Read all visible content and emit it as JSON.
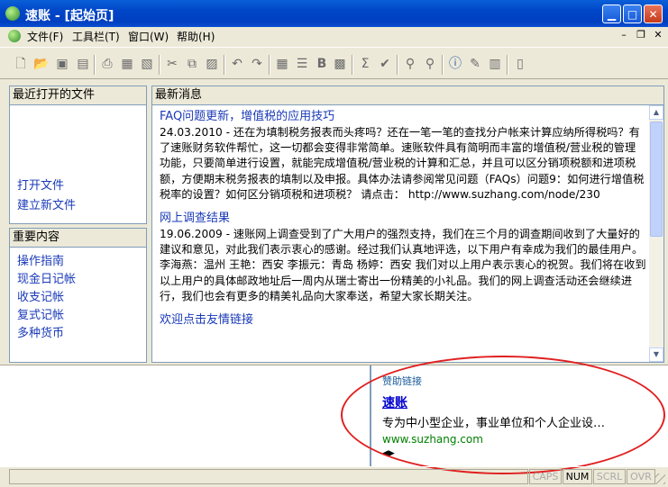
{
  "window": {
    "title": "速账 - [起始页]"
  },
  "menu": [
    "文件(F)",
    "工具栏(T)",
    "窗口(W)",
    "帮助(H)"
  ],
  "recent": {
    "header": "最近打开的文件",
    "links": [
      "打开文件",
      "建立新文件"
    ]
  },
  "important": {
    "header": "重要内容",
    "links": [
      "操作指南",
      "现金日记帐",
      "收支记帐",
      "复式记帐",
      "多种货币"
    ]
  },
  "news": {
    "header": "最新消息",
    "items": [
      {
        "title": "FAQ问题更新，增值税的应用技巧",
        "body": "24.03.2010 - 还在为填制税务报表而头疼吗？还在一笔一笔的查找分户帐来计算应纳所得税吗？有了速账财务软件帮忙，这一切都会变得非常简单。速账软件具有简明而丰富的增值税/营业税的管理功能，只要简单进行设置，就能完成增值税/营业税的计算和汇总，并且可以区分销项税额和进项税额，方便期末税务报表的填制以及申报。具体办法请参阅常见问题（FAQs）问题9：如何进行增值税税率的设置？如何区分销项税和进项税？ 请点击： http://www.suzhang.com/node/230"
      },
      {
        "title": "网上调查结果",
        "body": "19.06.2009 - 速账网上调查受到了广大用户的强烈支持，我们在三个月的调查期间收到了大量好的建议和意见，对此我们表示衷心的感谢。经过我们认真地评选，以下用户有幸成为我们的最佳用户。李海燕：温州 王艳：西安 李振元：青岛 杨婷：西安 我们对以上用户表示衷心的祝贺。我们将在收到以上用户的具体邮政地址后一周内从瑞士寄出一份精美的小礼品。我们的网上调查活动还会继续进行，我们也会有更多的精美礼品向大家奉送，希望大家长期关注。"
      },
      {
        "title": "欢迎点击友情链接",
        "body": ""
      }
    ]
  },
  "ad": {
    "caption": "赞助链接",
    "name": "速账",
    "description": "专为中小型企业，事业单位和个人企业设…",
    "url": "www.suzhang.com"
  },
  "status": [
    "CAPS",
    "NUM",
    "SCRL",
    "OVR"
  ]
}
